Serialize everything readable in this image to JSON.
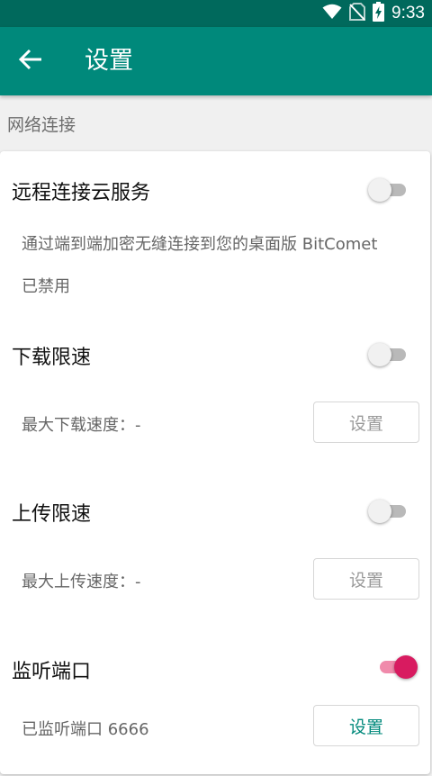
{
  "status_bar": {
    "time": "9:33",
    "icons": [
      "wifi-icon",
      "no-sim-icon",
      "battery-charging-icon"
    ]
  },
  "app_bar": {
    "title": "设置",
    "back_icon": "arrow-back-icon"
  },
  "section": {
    "title": "网络连接"
  },
  "prefs": {
    "cloud": {
      "title": "远程连接云服务",
      "description": "通过端到端加密无缝连接到您的桌面版 BitComet",
      "status": "已禁用",
      "enabled": false
    },
    "download": {
      "title": "下载限速",
      "status": "最大下载速度：-",
      "button_label": "设置",
      "enabled": false
    },
    "upload": {
      "title": "上传限速",
      "status": "最大上传速度：-",
      "button_label": "设置",
      "enabled": false
    },
    "port": {
      "title": "监听端口",
      "status": "已监听端口 6666",
      "button_label": "设置",
      "enabled": true
    }
  },
  "colors": {
    "status_bar": "#00695c",
    "app_bar": "#00897b",
    "accent": "#d81b60",
    "button_text_enabled": "#00897b"
  }
}
